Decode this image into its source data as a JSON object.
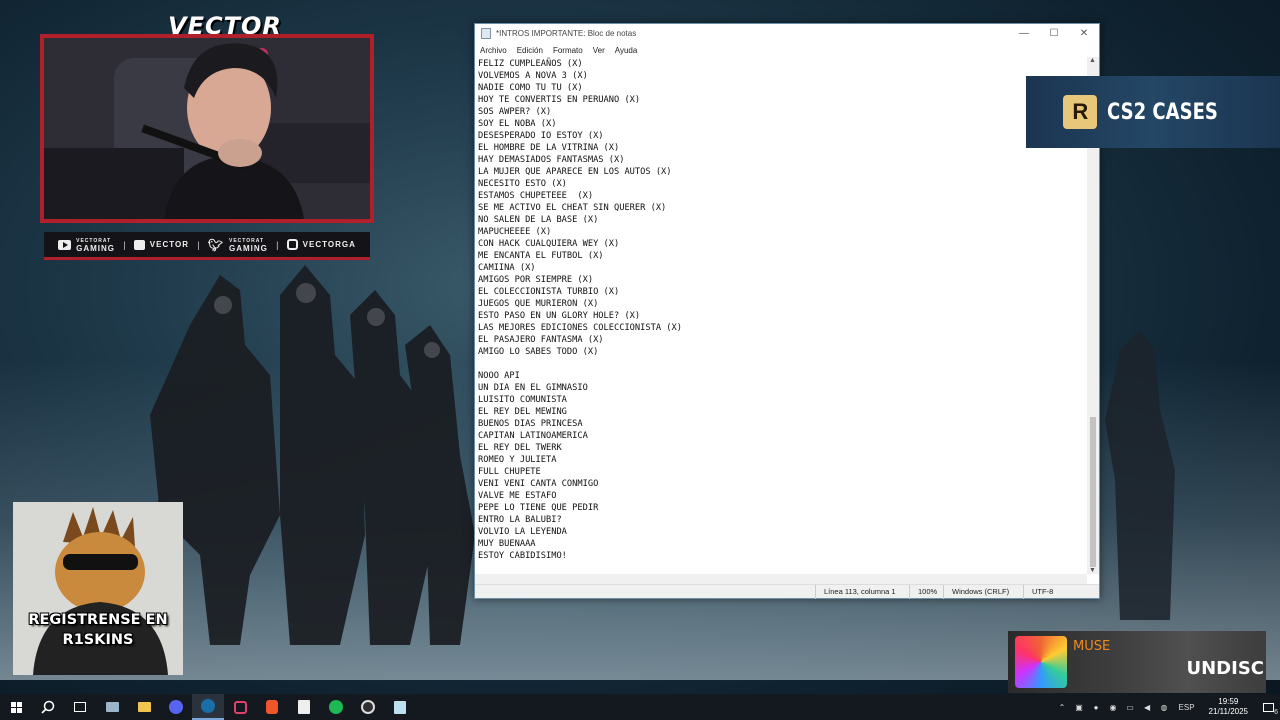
{
  "stream": {
    "cam_title": "VECTOR",
    "socials": [
      {
        "icon": "youtube-icon",
        "top": "VECTORAT",
        "label": "GAMING"
      },
      {
        "icon": "twitch-icon",
        "top": "",
        "label": "VECTOR"
      },
      {
        "icon": "twitter-icon",
        "top": "VECTORAT",
        "label": "GAMING"
      },
      {
        "icon": "instagram-icon",
        "top": "",
        "label": "VECTORGA"
      }
    ],
    "cs2_logo": "R",
    "cs2_label": "CS2 CASES",
    "promo_text": "REGISTRENSE EN R1SKINS"
  },
  "notepad": {
    "title": "*INTROS IMPORTANTE: Bloc de notas",
    "controls": {
      "minimize": "—",
      "maximize": "☐",
      "close": "✕"
    },
    "menu": [
      "Archivo",
      "Edición",
      "Formato",
      "Ver",
      "Ayuda"
    ],
    "lines": [
      "FELIZ CUMPLEAÑOS (X)",
      "VOLVEMOS A NOVA 3 (X)",
      "NADIE COMO TU TU (X)",
      "HOY TE CONVERTIS EN PERUANO (X)",
      "SOS AWPER? (X)",
      "SOY EL NOBA (X)",
      "DESESPERADO IO ESTOY (X)",
      "EL HOMBRE DE LA VITRINA (X)",
      "HAY DEMASIADOS FANTASMAS (X)",
      "LA MUJER QUE APARECE EN LOS AUTOS (X)",
      "NECESITO ESTO (X)",
      "ESTAMOS CHUPETEEE  (X)",
      "SE ME ACTIVO EL CHEAT SIN QUERER (X)",
      "NO SALEN DE LA BASE (X)",
      "MAPUCHEEEE (X)",
      "CON HACK CUALQUIERA WEY (X)",
      "ME ENCANTA EL FUTBOL (X)",
      "CAMIINA (X)",
      "AMIGOS POR SIEMPRE (X)",
      "EL COLECCIONISTA TURBIO (X)",
      "JUEGOS QUE MURIERON (X)",
      "ESTO PASO EN UN GLORY HOLE? (X)",
      "LAS MEJORES EDICIONES COLECCIONISTA (X)",
      "EL PASAJERO FANTASMA (X)",
      "AMIGO LO SABES TODO (X)",
      "",
      "NOOO API",
      "UN DIA EN EL GIMNASIO",
      "LUISITO COMUNISTA",
      "EL REY DEL MEWING",
      "BUENOS DIAS PRINCESA",
      "CAPITAN LATINOAMERICA",
      "EL REY DEL TWERK",
      "ROMEO Y JULIETA",
      "FULL CHUPETE",
      "VENI VENI CANTA CONMIGO",
      "VALVE ME ESTAFO",
      "PEPE LO TIENE QUE PEDIR",
      "ENTRO LA BALUBI?",
      "VOLVIO LA LEYENDA",
      "MUY BUENAAA",
      "ESTOY CABIDISIMO!"
    ],
    "status": {
      "position": "Línea 113, columna 1",
      "zoom": "100%",
      "line_ending": "Windows (CRLF)",
      "encoding": "UTF-8"
    }
  },
  "music": {
    "artist": "MUSE",
    "track": "UNDISC"
  },
  "taskbar": {
    "apps": [
      "windows-start-icon",
      "search-icon",
      "task-view-icon",
      "file-explorer-icon",
      "file-manager-icon",
      "discord-icon",
      "steam-icon",
      "app-icon",
      "brave-icon",
      "epic-games-icon",
      "spotify-icon",
      "obs-icon",
      "notepad-icon"
    ],
    "language": "ESP",
    "time": "19:59",
    "date": "21/11/2025",
    "notification_count": "6"
  },
  "colors": {
    "accent_red": "#b0202a",
    "music_orange": "#f08a1c"
  }
}
